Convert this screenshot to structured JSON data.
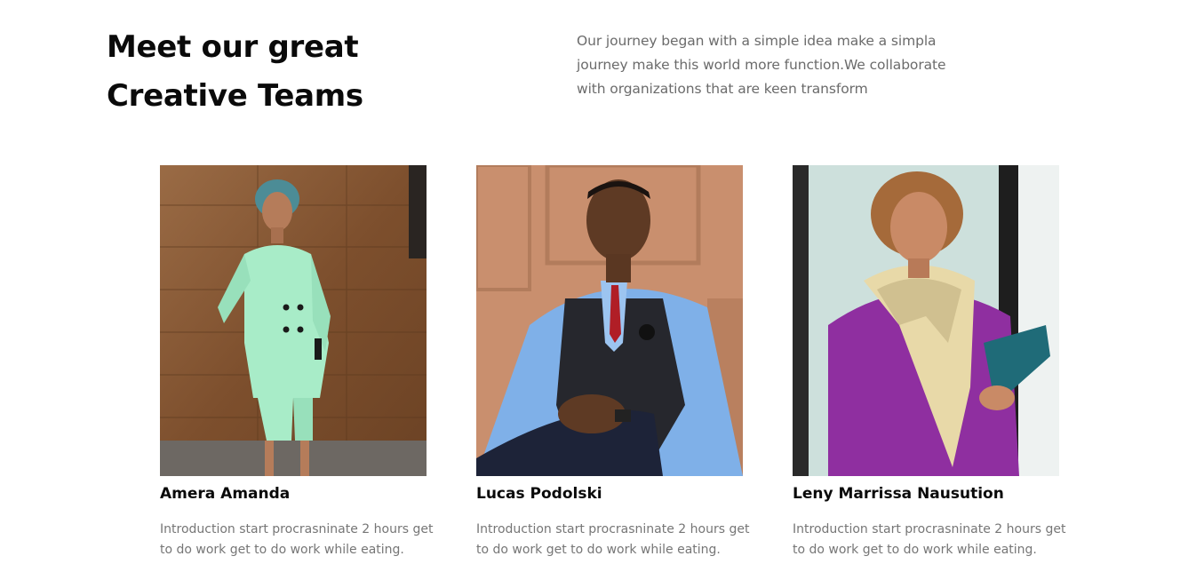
{
  "section": {
    "heading_line1": "Meet our great",
    "heading_line2": "Creative Teams",
    "intro_line1": "Our journey began with a simple idea make a simpla",
    "intro_line2": "journey make this world more function.We collaborate",
    "intro_line3": "with organizations that are keen transform"
  },
  "team": [
    {
      "name": "Amera Amanda",
      "desc_line1": "Introduction start procrasninate 2 hours get",
      "desc_line2": "to do work get to do work while eating.",
      "photo_icon": "portrait-photo-woman-mint-suit"
    },
    {
      "name": "Lucas Podolski",
      "desc_line1": "Introduction start procrasninate 2 hours get",
      "desc_line2": "to do work get to do work while eating.",
      "photo_icon": "portrait-photo-man-vest"
    },
    {
      "name": "Leny Marrissa Nausution",
      "desc_line1": "Introduction start procrasninate 2 hours get",
      "desc_line2": "to do work get to do work while eating.",
      "photo_icon": "portrait-photo-woman-purple-dress"
    }
  ],
  "colors": {
    "heading": "#0a0a0a",
    "body_text": "#767676",
    "wood_panel": "#8a5a36",
    "peach_wall": "#c98f6e",
    "purple_dress": "#8f2fa0"
  }
}
